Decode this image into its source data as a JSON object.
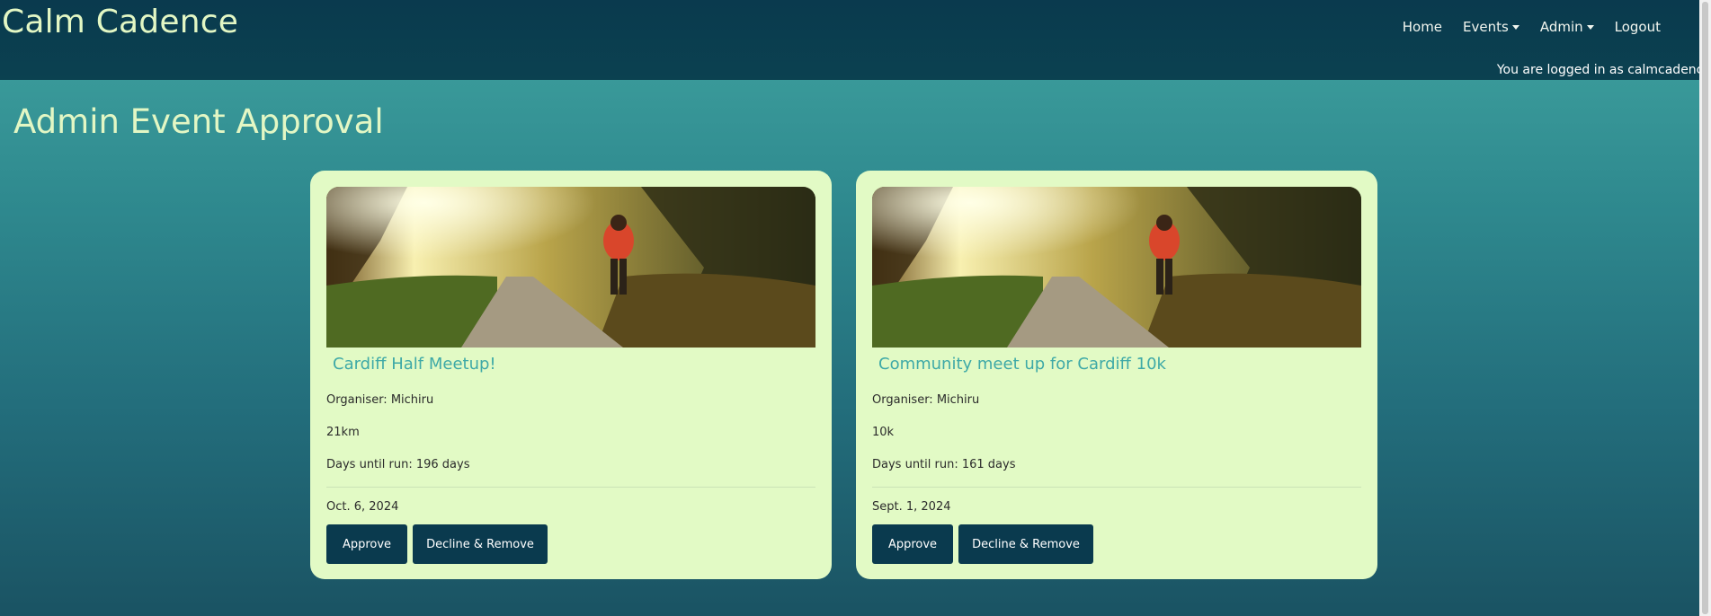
{
  "header": {
    "brand": "Calm Cadence",
    "nav": [
      {
        "label": "Home"
      },
      {
        "label": "Events",
        "dropdown": true
      },
      {
        "label": "Admin",
        "dropdown": true
      },
      {
        "label": "Logout"
      }
    ],
    "login_status": "You are logged in as calmcadence"
  },
  "page": {
    "title": "Admin Event Approval"
  },
  "events": [
    {
      "title": "Cardiff Half Meetup!",
      "organiser": "Organiser: Michiru",
      "distance": "21km",
      "days_until": "Days until run: 196 days",
      "date": "Oct. 6, 2024",
      "approve_label": "Approve",
      "decline_label": "Decline & Remove"
    },
    {
      "title": "Community meet up for Cardiff 10k",
      "organiser": "Organiser: Michiru",
      "distance": "10k",
      "days_until": "Days until run: 161 days",
      "date": "Sept. 1, 2024",
      "approve_label": "Approve",
      "decline_label": "Decline & Remove"
    }
  ],
  "colors": {
    "navbar": "#0a3a4e",
    "brand_text": "#e3f7c4",
    "card_bg": "#e2fac5",
    "card_title": "#3ea9a7",
    "button_bg": "#0a3a4e"
  }
}
